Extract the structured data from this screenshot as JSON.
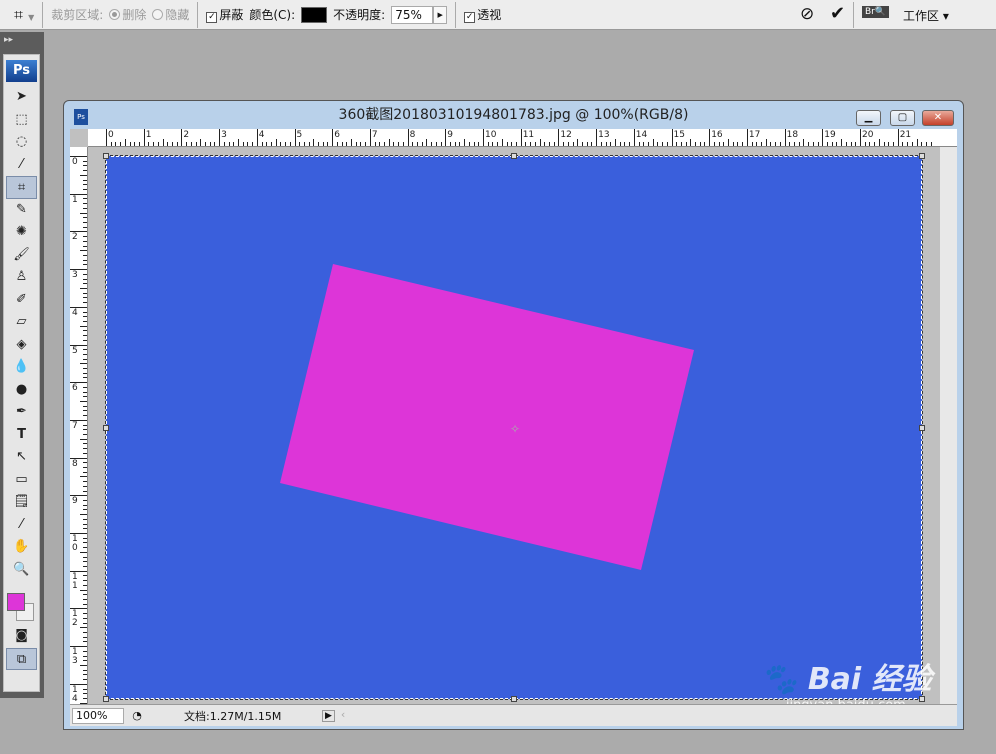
{
  "options": {
    "crop_area_label": "裁剪区域:",
    "delete_label": "删除",
    "hide_label": "隐藏",
    "shield_label": "屏蔽",
    "shield_checked": true,
    "color_label": "颜色(C):",
    "color_value": "#000000",
    "opacity_label": "不透明度:",
    "opacity_value": "75%",
    "perspective_label": "透视",
    "perspective_checked": true,
    "workspace_label": "工作区"
  },
  "toolbox": {
    "logo": "Ps",
    "tools": [
      "move",
      "marquee",
      "lasso",
      "quick-selection",
      "crop",
      "slice",
      "healing",
      "brush",
      "stamp",
      "history-brush",
      "eraser",
      "paint-bucket",
      "blur",
      "dodge",
      "pen",
      "type",
      "path-selection",
      "shape",
      "notes",
      "eyedropper",
      "hand",
      "zoom"
    ],
    "foreground": "#dd35d8",
    "background": "#f0f0f0"
  },
  "window": {
    "title": "360截图20180310194801783.jpg @ 100%(RGB/8)",
    "ruler_top": [
      "0",
      "1",
      "2",
      "3",
      "4",
      "5",
      "6",
      "7",
      "8",
      "9",
      "10",
      "11",
      "12",
      "13",
      "14",
      "15",
      "16",
      "17",
      "18",
      "19",
      "20",
      "21"
    ],
    "ruler_left": [
      "0",
      "1",
      "2",
      "3",
      "4",
      "5",
      "6",
      "7",
      "8",
      "9",
      "10",
      "11",
      "12",
      "13",
      "14"
    ]
  },
  "canvas": {
    "background": "#3a5fdc",
    "shape_color": "#dd35d8"
  },
  "status": {
    "zoom": "100%",
    "doc_info": "文档:1.27M/1.15M"
  },
  "watermark": {
    "text": "Bai 经验",
    "url": "jingyan.baidu.com"
  }
}
